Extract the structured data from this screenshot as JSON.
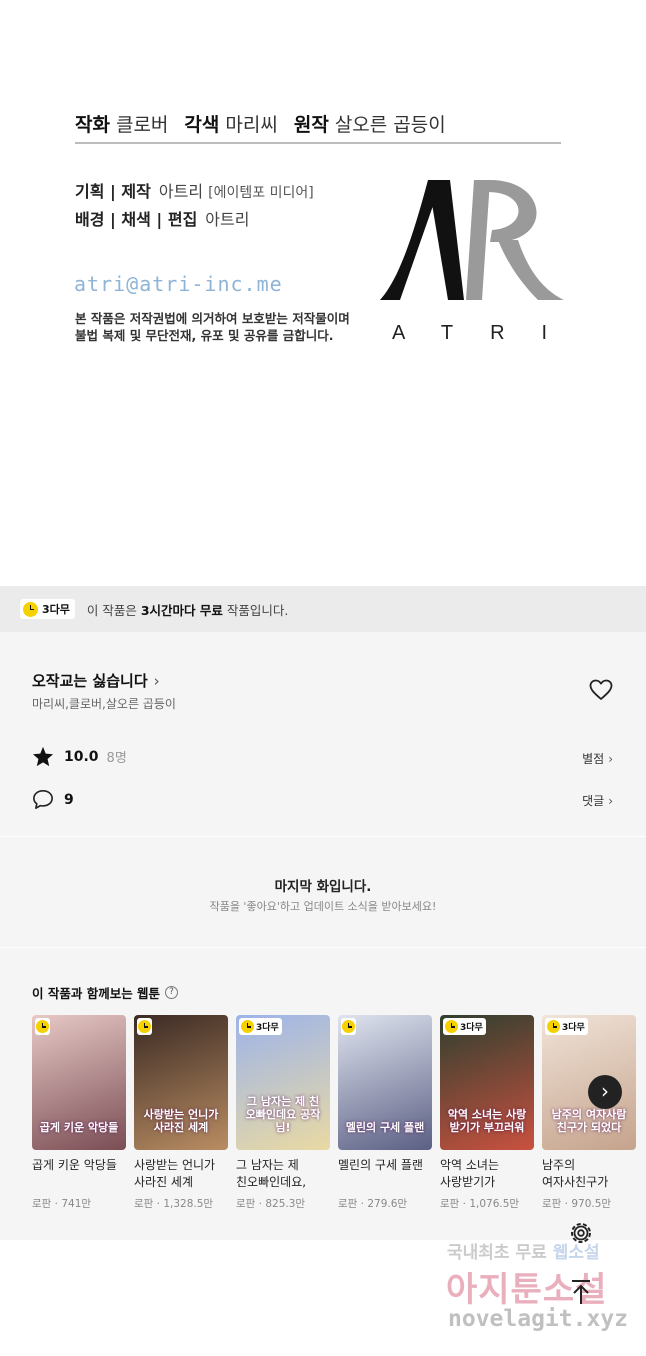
{
  "credits": {
    "story_label": "작화",
    "story_value": "클로버",
    "color_label": "각색",
    "color_value": "마리씨",
    "original_label": "원작",
    "original_value": "살오른 곱등이",
    "planning_label": "기획 | 제작",
    "planning_value": "아트리",
    "planning_note": "[에이템포 미디어]",
    "bg_label": "배경 | 채색 | 편집",
    "bg_value": "아트리",
    "email": "atri@atri-inc.me",
    "notice_line1": "본 작품은 저작권법에 의거하여 보호받는 저작물이며",
    "notice_line2": "불법 복제 및 무단전재, 유포 및 공유를 금합니다.",
    "logo_word": "ATRI"
  },
  "free_banner": {
    "badge": "3다무",
    "text_prefix": "이 작품은 ",
    "text_bold": "3시간마다 무료",
    "text_suffix": " 작품입니다."
  },
  "work": {
    "title": "오작교는 싫습니다",
    "authors": "마리씨,클로버,살오른 곱등이",
    "rating": "10.0",
    "rating_count": "8명",
    "rating_link": "별점",
    "comments": "9",
    "comments_link": "댓글"
  },
  "last_episode": {
    "title": "마지막 화입니다.",
    "subtitle": "작품을 '좋아요'하고 업데이트 소식을 받아보세요!"
  },
  "recommendations": {
    "heading": "이 작품과 함께보는 웹툰",
    "help": "?",
    "items": [
      {
        "title": "곱게 키운 악당들",
        "genre": "로판",
        "views": "741만",
        "badge": "",
        "cover_text": "곱게 키운 악당들",
        "colors": [
          "#e7c9c6",
          "#7a4d54"
        ]
      },
      {
        "title": "사랑받는 언니가 사라진 세계",
        "genre": "로판",
        "views": "1,328.5만",
        "badge": "",
        "cover_text": "사랑받는 언니가 사라진 세계",
        "colors": [
          "#3b2a24",
          "#b98d62"
        ]
      },
      {
        "title": "그 남자는 제 친오빠인데요, 공작님",
        "genre": "로판",
        "views": "825.3만",
        "badge": "3다무",
        "cover_text": "그 남자는 제 친오빠인데요 공작님!",
        "colors": [
          "#9db4ea",
          "#e9d9a3"
        ]
      },
      {
        "title": "멜린의 구세 플랜",
        "genre": "로판",
        "views": "279.6만",
        "badge": "",
        "cover_text": "멜린의 구세 플랜",
        "colors": [
          "#dfe4ef",
          "#5b5f84"
        ]
      },
      {
        "title": "악역 소녀는 사랑받기가 부끄러워",
        "genre": "로판",
        "views": "1,076.5만",
        "badge": "3다무",
        "cover_text": "악역 소녀는 사랑받기가 부끄러워",
        "colors": [
          "#2f3f2f",
          "#c9513f"
        ]
      },
      {
        "title": "남주의 여자사친구가 되었다",
        "genre": "로판",
        "views": "970.5만",
        "badge": "3다무",
        "cover_text": "남주의 여자사람친구가 되었다",
        "colors": [
          "#f0e3d8",
          "#c5a38c"
        ]
      }
    ],
    "next_icon": "chevron-right-icon"
  },
  "watermark": {
    "line1_a": "국내최초 무료 ",
    "line1_b": "웹소설",
    "line2": "아지툰소설",
    "line3": "novelagit.xyz"
  },
  "icons": {
    "heart": "heart-outline-icon",
    "star": "star-icon",
    "comment": "speech-bubble-icon",
    "gear": "gear-icon",
    "scroll_top": "arrow-up-icon",
    "free_clock": "clock-icon"
  },
  "colors": {
    "badge_yellow": "#f6d100",
    "banner_bg": "#ebebeb",
    "section_bg": "#f5f5f5",
    "email_blue": "#8fb4d6"
  }
}
